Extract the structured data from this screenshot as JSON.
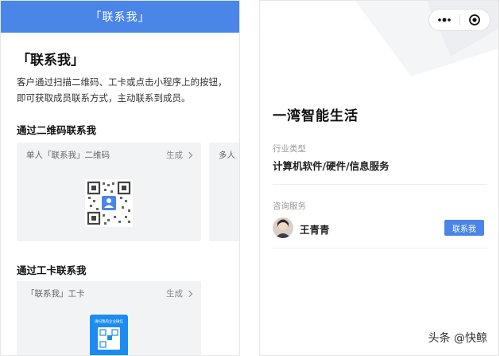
{
  "left": {
    "header_title": "「联系我」",
    "title": "「联系我」",
    "description": "客户通过扫描二维码、工卡或点击小程序上的按钮，即可获取成员联系方式，主动联系到成员。",
    "qr_section": {
      "title": "通过二维码联系我",
      "card1_label": "单人「联系我」二维码",
      "card1_action": "生成",
      "card2_label": "多人"
    },
    "badge_section": {
      "title": "通过工卡联系我",
      "card_label": "「联系我」工卡",
      "card_action": "生成",
      "badge_text": "请扫我的企业微信"
    }
  },
  "right": {
    "company_name": "一湾智能生活",
    "industry_label": "行业类型",
    "industry_value": "计算机软件/硬件/信息服务",
    "service_label": "咨询服务",
    "staff_name": "王青青",
    "contact_button": "联系我"
  },
  "watermark": "头条 @快鲸",
  "colors": {
    "accent": "#4a86e8",
    "card_bg": "#f2f3f5"
  },
  "icons": {
    "more": "more-dots-icon",
    "close": "target-close-icon",
    "chevron": "chevron-right-icon"
  }
}
